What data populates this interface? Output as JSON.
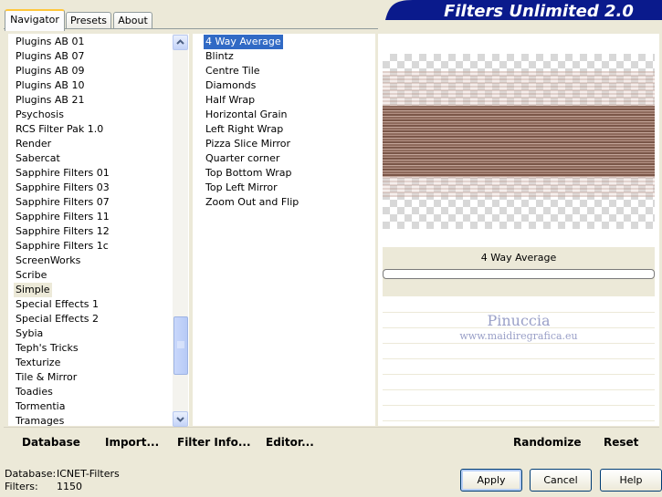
{
  "tabs": [
    {
      "label": "Navigator"
    },
    {
      "label": "Presets"
    },
    {
      "label": "About"
    }
  ],
  "title": "Filters Unlimited 2.0",
  "categories": [
    "Plugins AB 01",
    "Plugins AB 07",
    "Plugins AB 09",
    "Plugins AB 10",
    "Plugins AB 21",
    "Psychosis",
    "RCS Filter Pak 1.0",
    "Render",
    "Sabercat",
    "Sapphire Filters 01",
    "Sapphire Filters 03",
    "Sapphire Filters 07",
    "Sapphire Filters 11",
    "Sapphire Filters 12",
    "Sapphire Filters 1c",
    "ScreenWorks",
    "Scribe",
    "Simple",
    "Special Effects 1",
    "Special Effects 2",
    "Sybia",
    "Teph's Tricks",
    "Texturize",
    "Tile & Mirror",
    "Toadies",
    "Tormentia",
    "Tramages"
  ],
  "selected_category": "Simple",
  "filters": [
    "4 Way Average",
    "Blintz",
    "Centre Tile",
    "Diamonds",
    "Half Wrap",
    "Horizontal Grain",
    "Left Right Wrap",
    "Pizza Slice Mirror",
    "Quarter corner",
    "Top Bottom Wrap",
    "Top Left Mirror",
    "Zoom Out and Flip"
  ],
  "selected_filter": "4 Way Average",
  "preview": {
    "filter_name": "4 Way Average",
    "watermark_name": "Pinuccia",
    "watermark_url": "www.maidiregrafica.eu"
  },
  "toolbar": {
    "database": "Database",
    "import": "Import...",
    "filter_info": "Filter Info...",
    "editor": "Editor...",
    "randomize": "Randomize",
    "reset": "Reset"
  },
  "status": {
    "database_label": "Database:",
    "database_value": "ICNET-Filters",
    "filters_label": "Filters:",
    "filters_value": "1150"
  },
  "dialog": {
    "apply": "Apply",
    "cancel": "Cancel",
    "help": "Help"
  },
  "colors": {
    "selection": "#316ac5",
    "banner": "#0a1a8c",
    "window": "#ece9d8"
  }
}
